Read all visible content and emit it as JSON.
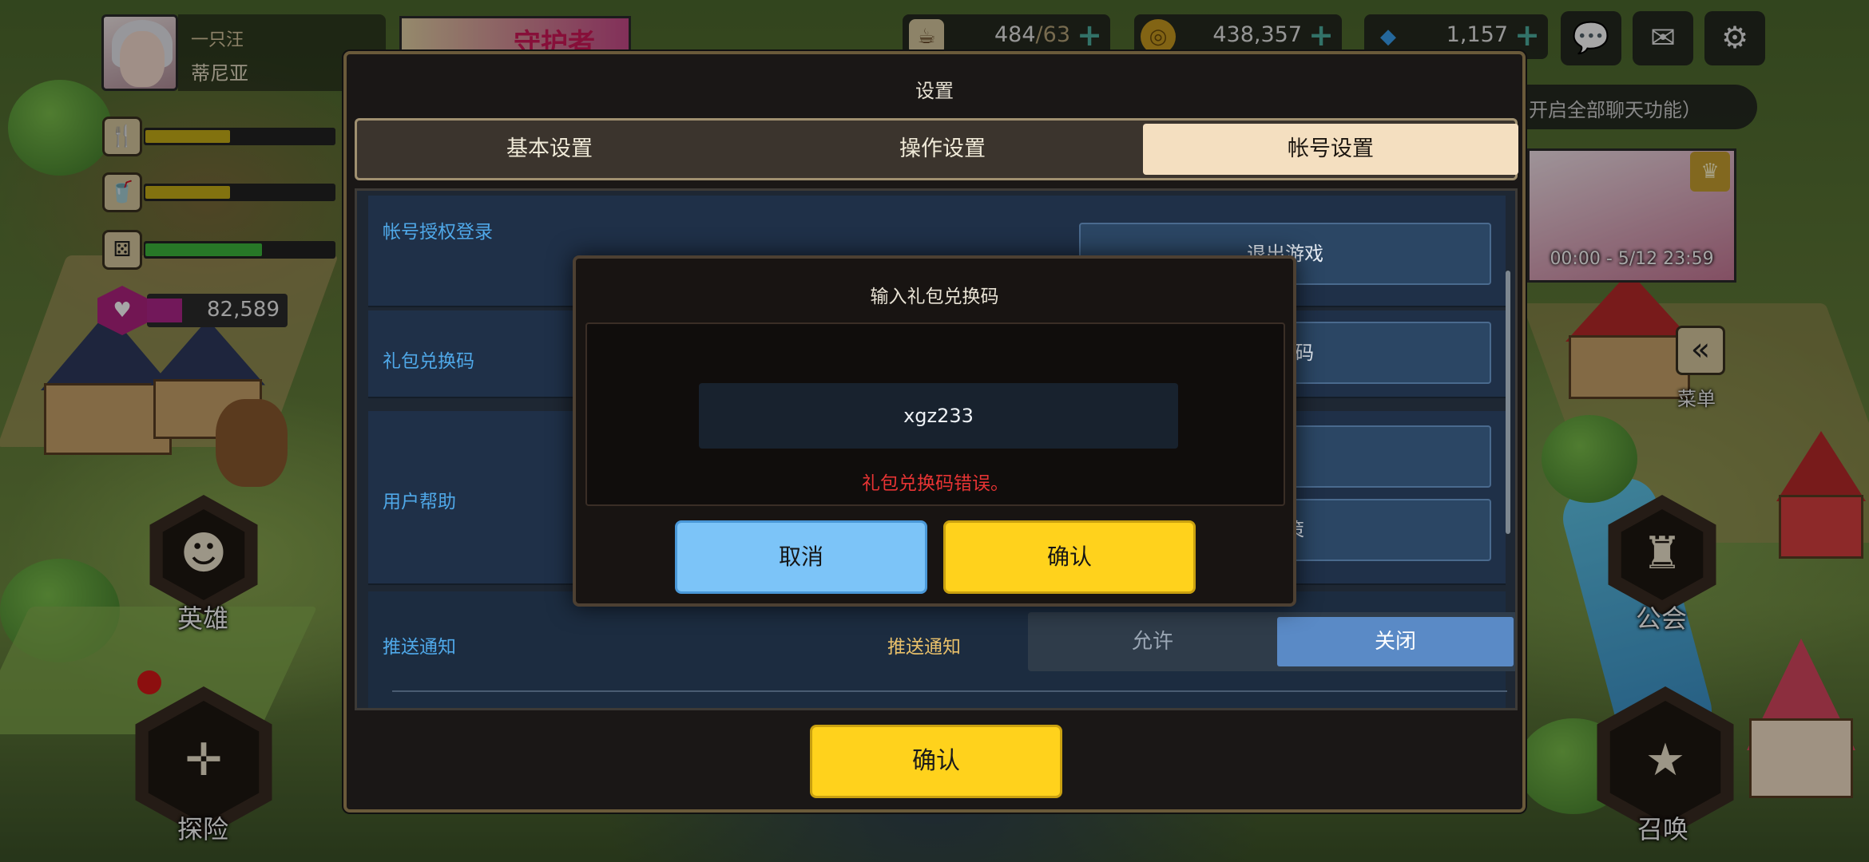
{
  "player": {
    "name": "一只汪",
    "subtitle": "蒂尼亚"
  },
  "banner": {
    "text": "守护者"
  },
  "stats": [
    {
      "icon": "fork-knife-icon",
      "glyph": "🍴",
      "fill": 0.45,
      "color": "#c8b018"
    },
    {
      "icon": "cup-icon",
      "glyph": "🥤",
      "fill": 0.45,
      "color": "#c8b018"
    },
    {
      "icon": "dice-icon",
      "glyph": "⚄",
      "fill": 0.62,
      "color": "#3cb83c"
    }
  ],
  "gems": {
    "value": "82,589"
  },
  "resources": {
    "stamina": {
      "value": "484",
      "max": "/63"
    },
    "gold": {
      "value": "438,357"
    },
    "diamond": {
      "value": "1,157"
    }
  },
  "chat_notice": "开启全部聊天功能）",
  "event": {
    "time": "00:00 - 5/12 23:59"
  },
  "menu_label": "菜单",
  "nav": {
    "hero": "英雄",
    "adventure": "探险",
    "guild": "公会",
    "summon": "召唤"
  },
  "settings": {
    "title": "设置",
    "tabs": [
      {
        "label": "基本设置",
        "active": false
      },
      {
        "label": "操作设置",
        "active": false
      },
      {
        "label": "帐号设置",
        "active": true
      }
    ],
    "sections": {
      "account_login": {
        "label": "帐号授权登录",
        "button": "退出游戏"
      },
      "gift_code": {
        "label": "礼包兑换码",
        "button": "兑换码"
      },
      "help": {
        "label": "用户帮助",
        "button1": "",
        "button2": "政策"
      },
      "push": {
        "label": "推送通知",
        "sublabel": "推送通知",
        "allow": "允许",
        "deny": "关闭"
      }
    },
    "confirm": "确认"
  },
  "dialog": {
    "title": "输入礼包兑换码",
    "input_value": "xgz233",
    "error": "礼包兑换码错误。",
    "cancel": "取消",
    "ok": "确认"
  },
  "colors": {
    "accent_yellow": "#ffd21c",
    "accent_blue": "#7cc4f8",
    "error_red": "#e83434",
    "section_label": "#4fa8e8"
  }
}
